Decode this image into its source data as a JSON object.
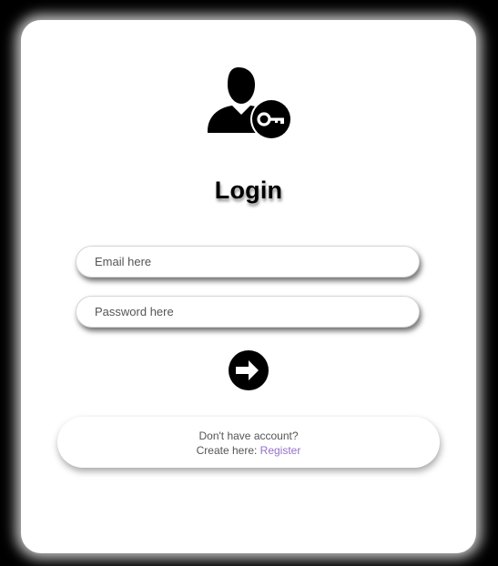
{
  "login": {
    "title": "Login",
    "email_placeholder": "Email here",
    "password_placeholder": "Password here",
    "submit_icon": "arrow-right-circle-icon",
    "header_icon": "user-key-icon"
  },
  "register": {
    "prompt": "Don't have account?",
    "create_text": "Create here:",
    "link_label": "Register"
  },
  "colors": {
    "background": "#000000",
    "card": "#ffffff",
    "link": "#9370c8"
  }
}
